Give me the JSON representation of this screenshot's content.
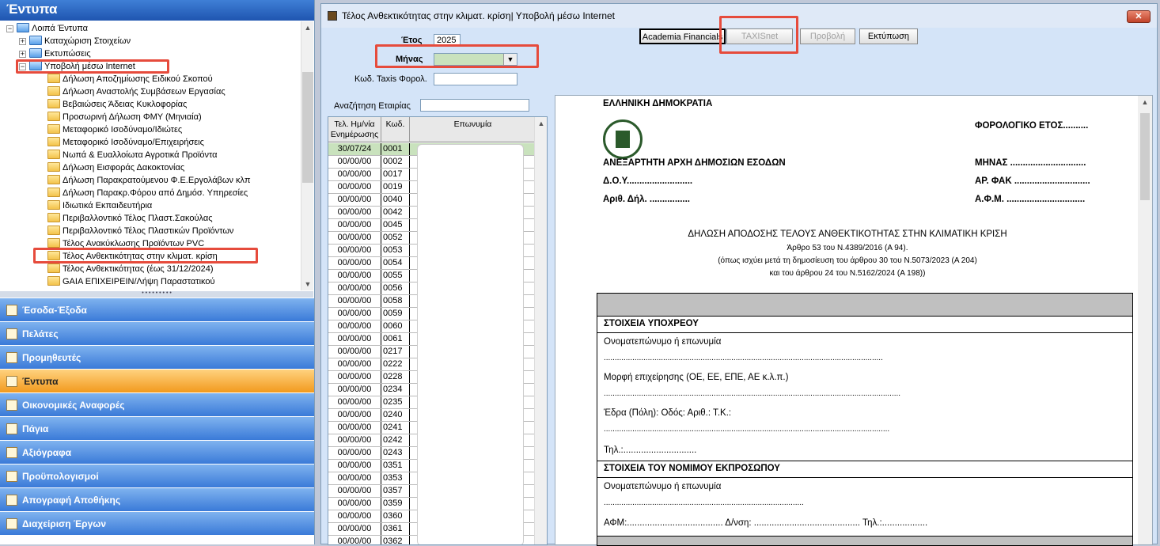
{
  "left_panel": {
    "title": "Έντυπα",
    "tree": [
      {
        "label": "Λοιπά Έντυπα",
        "level": 0,
        "type": "blue",
        "pm": "−"
      },
      {
        "label": "Καταχώριση Στοιχείων",
        "level": 1,
        "type": "blue",
        "pm": "+"
      },
      {
        "label": "Εκτυπώσεις",
        "level": 1,
        "type": "blue",
        "pm": "+"
      },
      {
        "label": "Υποβολή μέσω Internet",
        "level": 1,
        "type": "blue",
        "pm": "−"
      },
      {
        "label": "Δήλωση Αποζημίωσης Ειδικού Σκοπού",
        "level": 2,
        "type": "yellow"
      },
      {
        "label": "Δήλωση Αναστολής Συμβάσεων Εργασίας",
        "level": 2,
        "type": "yellow"
      },
      {
        "label": "Βεβαιώσεις Άδειας Κυκλοφορίας",
        "level": 2,
        "type": "yellow"
      },
      {
        "label": "Προσωρινή Δήλωση ΦΜΥ (Μηνιαία)",
        "level": 2,
        "type": "yellow"
      },
      {
        "label": "Μεταφορικό Ισοδύναμο/Ιδιώτες",
        "level": 2,
        "type": "yellow"
      },
      {
        "label": "Μεταφορικό Ισοδύναμο/Επιχειρήσεις",
        "level": 2,
        "type": "yellow"
      },
      {
        "label": "Νωπά & Ευαλλοίωτα Αγροτικά Προϊόντα",
        "level": 2,
        "type": "yellow"
      },
      {
        "label": "Δήλωση Εισφοράς Δακοκτονίας",
        "level": 2,
        "type": "yellow"
      },
      {
        "label": "Δήλωση Παρακρατούμενου Φ.Ε.Εργολάβων κλπ",
        "level": 2,
        "type": "yellow"
      },
      {
        "label": "Δήλωση Παρακρ.Φόρου από Δημόσ. Υπηρεσίες",
        "level": 2,
        "type": "yellow"
      },
      {
        "label": "Ιδιωτικά Εκπαιδευτήρια",
        "level": 2,
        "type": "yellow"
      },
      {
        "label": "Περιβαλλοντικό Τέλος Πλαστ.Σακούλας",
        "level": 2,
        "type": "yellow"
      },
      {
        "label": "Περιβαλλοντικό Τέλος Πλαστικών Προϊόντων",
        "level": 2,
        "type": "yellow"
      },
      {
        "label": "Τέλος Ανακύκλωσης Προϊόντων PVC",
        "level": 2,
        "type": "yellow"
      },
      {
        "label": "Τέλος Ανθεκτικότητας στην κλιματ. κρίση",
        "level": 2,
        "type": "yellow"
      },
      {
        "label": "Τέλος Ανθεκτικότητας (έως 31/12/2024)",
        "level": 2,
        "type": "yellow"
      },
      {
        "label": "GAIA ΕΠΙΧΕΙΡΕΙΝ/Λήψη Παραστατικού",
        "level": 2,
        "type": "yellow"
      }
    ],
    "nav": [
      {
        "label": "Έσοδα-Έξοδα",
        "active": false
      },
      {
        "label": "Πελάτες",
        "active": false
      },
      {
        "label": "Προμηθευτές",
        "active": false
      },
      {
        "label": "Έντυπα",
        "active": true
      },
      {
        "label": "Οικονομικές Αναφορές",
        "active": false
      },
      {
        "label": "Πάγια",
        "active": false
      },
      {
        "label": "Αξιόγραφα",
        "active": false
      },
      {
        "label": "Προϋπολογισμοί",
        "active": false
      },
      {
        "label": "Απογραφή Αποθήκης",
        "active": false
      },
      {
        "label": "Διαχείριση Έργων",
        "active": false
      }
    ]
  },
  "window": {
    "title": "Τέλος Ανθεκτικότητας στην κλιματ. κρίση| Υποβολή μέσω Internet",
    "close": "✕",
    "year_label": "Έτος",
    "year_value": "2025",
    "month_label": "Μήνας",
    "month_value": "",
    "taxis_label": "Κωδ. Taxis Φορολ.",
    "taxis_value": "",
    "search_label": "Αναζήτηση Εταιρίας",
    "search_value": "",
    "buttons": {
      "academia": "Academia Financials",
      "taxisnet": "TAXISnet",
      "preview": "Προβολή",
      "print": "Εκτύπωση"
    }
  },
  "grid": {
    "headers": [
      "Τελ. Ημ/νία Ενημέρωσης",
      "Κωδ.",
      "Επωνυμία"
    ],
    "rows": [
      [
        "30/07/24",
        "0001"
      ],
      [
        "00/00/00",
        "0002"
      ],
      [
        "00/00/00",
        "0017"
      ],
      [
        "00/00/00",
        "0019"
      ],
      [
        "00/00/00",
        "0040"
      ],
      [
        "00/00/00",
        "0042"
      ],
      [
        "00/00/00",
        "0045"
      ],
      [
        "00/00/00",
        "0052"
      ],
      [
        "00/00/00",
        "0053"
      ],
      [
        "00/00/00",
        "0054"
      ],
      [
        "00/00/00",
        "0055"
      ],
      [
        "00/00/00",
        "0056"
      ],
      [
        "00/00/00",
        "0058"
      ],
      [
        "00/00/00",
        "0059"
      ],
      [
        "00/00/00",
        "0060"
      ],
      [
        "00/00/00",
        "0061"
      ],
      [
        "00/00/00",
        "0217"
      ],
      [
        "00/00/00",
        "0222"
      ],
      [
        "00/00/00",
        "0228"
      ],
      [
        "00/00/00",
        "0234"
      ],
      [
        "00/00/00",
        "0235"
      ],
      [
        "00/00/00",
        "0240"
      ],
      [
        "00/00/00",
        "0241"
      ],
      [
        "00/00/00",
        "0242"
      ],
      [
        "00/00/00",
        "0243"
      ],
      [
        "00/00/00",
        "0351"
      ],
      [
        "00/00/00",
        "0353"
      ],
      [
        "00/00/00",
        "0357"
      ],
      [
        "00/00/00",
        "0359"
      ],
      [
        "00/00/00",
        "0360"
      ],
      [
        "00/00/00",
        "0361"
      ],
      [
        "00/00/00",
        "0362"
      ]
    ]
  },
  "document": {
    "republic": "ΕΛΛΗΝΙΚΗ ΔΗΜΟΚΡΑΤΙΑ",
    "tax_year": "ΦΟΡΟΛΟΓΙΚΟ ΕΤΟΣ..........",
    "authority": "ΑΝΕΞΑΡΤΗΤΗ ΑΡΧΗ ΔΗΜΟΣΙΩΝ ΕΣΟΔΩΝ",
    "month": "ΜΗΝΑΣ ..............................",
    "doy": "Δ.Ο.Υ..........................",
    "ar_fak": "ΑΡ. ΦΑΚ ..............................",
    "ar_dil": "Αριθ. Δήλ. ................",
    "afm": "Α.Φ.Μ. ...............................",
    "heading": "ΔΗΛΩΣΗ ΑΠΟΔΟΣΗΣ ΤΕΛΟΥΣ ΑΝΘΕΚΤΙΚΟΤΗΤΑΣ ΣΤΗΝ ΚΛΙΜΑΤΙΚΗ ΚΡΙΣΗ",
    "sub1": "Άρθρο 53 του Ν.4389/2016 (Α 94).",
    "sub2": "(όπως ισχύει μετά τη δημοσίευση του άρθρου 30 του Ν.5073/2023 (Α 204)",
    "sub3": "και του άρθρου 24 του Ν.5162/2024 (Α 198))",
    "sec1": "ΣΤΟΙΧΕΙΑ ΥΠΟΧΡΕΟΥ",
    "f1": "Ονοματεπώνυμο ή επωνυμία",
    "f1_dots": "...............................................................................................................................",
    "f2": "Μορφή επιχείρησης (ΟΕ, ΕΕ, ΕΠΕ, ΑΕ κ.λ.π.)",
    "f2_dots": ".......................................................................................................................................",
    "f3": "Έδρα (Πόλη): Οδός: Αριθ.: Τ.Κ.:",
    "f3_dots": "..................................................................................................................................",
    "f4": "Τηλ.:.............................",
    "sec2": "ΣΤΟΙΧΕΙΑ ΤΟΥ ΝΟΜΙΜΟΥ ΕΚΠΡΟΣΩΠΟΥ",
    "f5": "Ονοματεπώνυμο ή επωνυμία",
    "f5_dots": "...........................................................................................",
    "f6": "ΑΦΜ:...................................... Δ/νση: .......................................... Τηλ.:.................."
  },
  "colors": {
    "highlight": "#e64b3c",
    "selected_row": "#c9e2bd",
    "month_field": "#c9e2bd",
    "active_nav": "#f29a1e"
  }
}
